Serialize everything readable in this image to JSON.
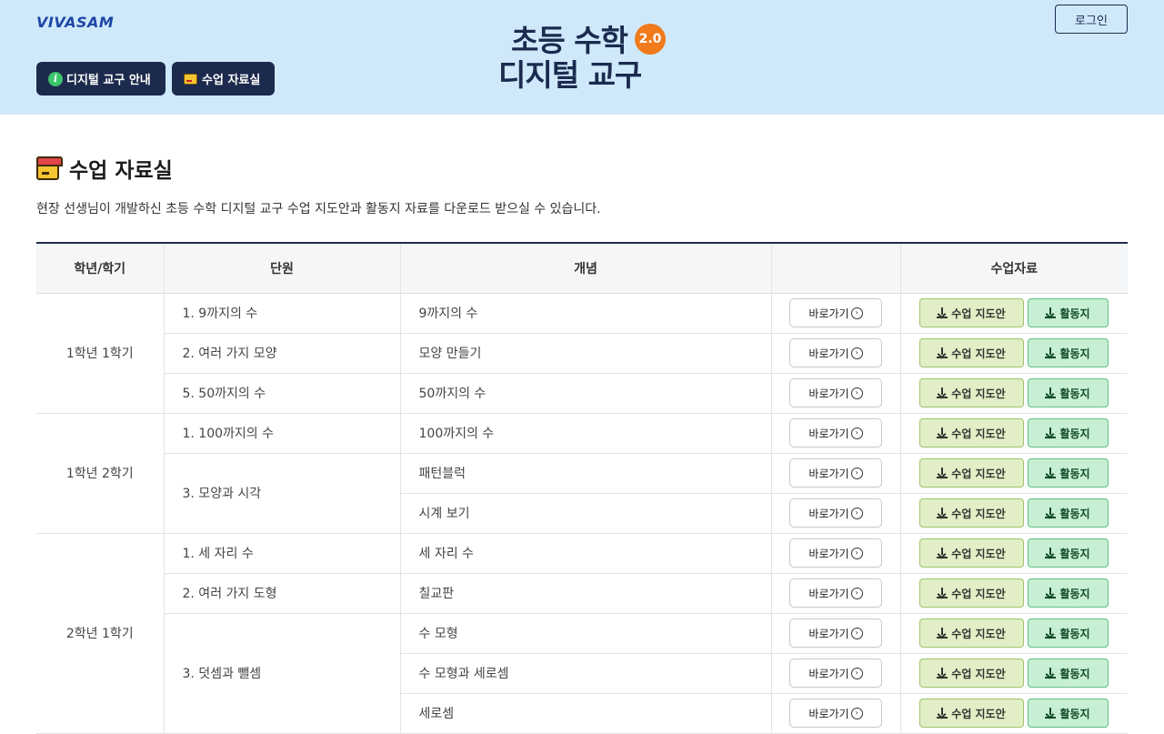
{
  "header": {
    "logo": "VIVASAM",
    "brand_line1": "초등 수학",
    "brand_line2": "디지털 교구",
    "brand_badge": "2.0",
    "nav_guide": "디지털 교구 안내",
    "nav_materials": "수업 자료실",
    "login": "로그인"
  },
  "section": {
    "title": "수업 자료실",
    "description": "현장 선생님이 개발하신 초등 수학 디지털 교구 수업 지도안과 활동지 자료를 다운로드 받으실 수 있습니다."
  },
  "table": {
    "headers": [
      "학년/학기",
      "단원",
      "개념",
      "",
      "수업자료"
    ],
    "go_label": "바로가기",
    "go_icon": "›",
    "plan_label": "수업 지도안",
    "work_label": "활동지",
    "grades": [
      "1학년 1학기",
      "1학년 2학기",
      "2학년 1학기"
    ],
    "units": [
      "1. 9까지의 수",
      "2. 여러 가지 모양",
      "5. 50까지의 수",
      "1. 100까지의 수",
      "3. 모양과 시각",
      "1. 세 자리 수",
      "2. 여러 가지 도형",
      "3. 덧셈과 뺄셈"
    ],
    "concepts": [
      "9까지의 수",
      "모양 만들기",
      "50까지의 수",
      "100까지의 수",
      "패턴블럭",
      "시계 보기",
      "세 자리 수",
      "칠교판",
      "수 모형",
      "수 모형과 세로셈",
      "세로셈"
    ]
  }
}
